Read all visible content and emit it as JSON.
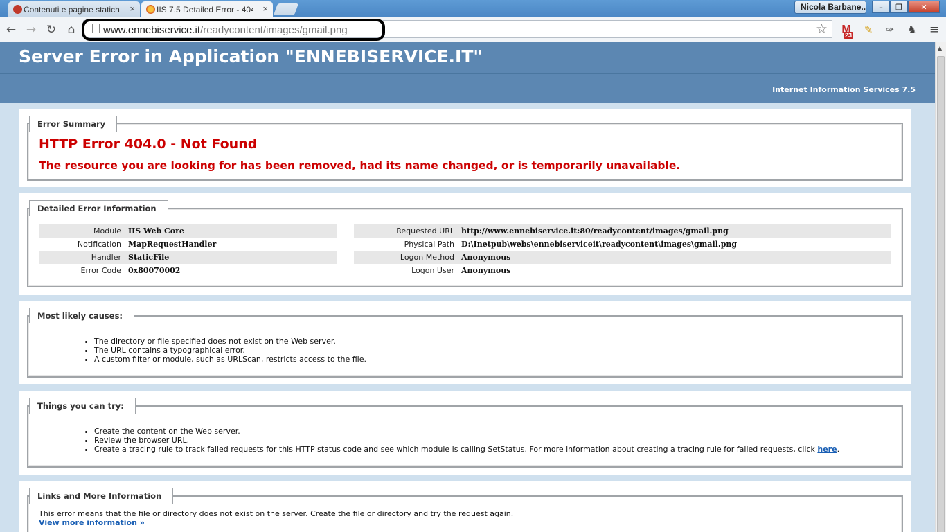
{
  "browser": {
    "tabs": [
      {
        "title": "Contenuti e pagine statich",
        "close": "×"
      },
      {
        "title": "IIS 7.5 Detailed Error - 404.",
        "close": "×"
      }
    ],
    "user_name": "Nicola Barbane...",
    "window_controls": [
      "–",
      "❐",
      "✕"
    ],
    "url_host": "www.ennebiservice.it",
    "url_path": "/readycontent/images/gmail.png",
    "gmail_badge": "23",
    "icons": [
      "back-icon",
      "forward-icon",
      "reload-icon",
      "home-icon",
      "page-icon",
      "star-icon",
      "gmail-icon",
      "notepad-icon",
      "extension-icon",
      "evernote-icon",
      "menu-icon"
    ]
  },
  "page": {
    "title": "Server Error in Application \"ENNEBISERVICE.IT\"",
    "server": "Internet Information Services 7.5",
    "summary": {
      "legend": "Error Summary",
      "heading": "HTTP Error 404.0 - Not Found",
      "description": "The resource you are looking for has been removed, had its name changed, or is temporarily unavailable."
    },
    "details": {
      "legend": "Detailed Error Information",
      "left": [
        {
          "key": "Module",
          "value": "IIS Web Core"
        },
        {
          "key": "Notification",
          "value": "MapRequestHandler"
        },
        {
          "key": "Handler",
          "value": "StaticFile"
        },
        {
          "key": "Error Code",
          "value": "0x80070002"
        }
      ],
      "right": [
        {
          "key": "Requested URL",
          "value": "http://www.ennebiservice.it:80/readycontent/images/gmail.png"
        },
        {
          "key": "Physical Path",
          "value": "D:\\Inetpub\\webs\\ennebiserviceit\\readycontent\\images\\gmail.png"
        },
        {
          "key": "Logon Method",
          "value": "Anonymous"
        },
        {
          "key": "Logon User",
          "value": "Anonymous"
        }
      ]
    },
    "causes": {
      "legend": "Most likely causes:",
      "items": [
        "The directory or file specified does not exist on the Web server.",
        "The URL contains a typographical error.",
        "A custom filter or module, such as URLScan, restricts access to the file."
      ]
    },
    "try": {
      "legend": "Things you can try:",
      "items": [
        "Create the content on the Web server.",
        "Review the browser URL.",
        "Create a tracing rule to track failed requests for this HTTP status code and see which module is calling SetStatus. For more information about creating a tracing rule for failed requests, click"
      ],
      "link_text": "here",
      "link_suffix": "."
    },
    "links": {
      "legend": "Links and More Information",
      "text": "This error means that the file or directory does not exist on the server. Create the file or directory and try the request again.",
      "more_link": "View more information »"
    }
  }
}
